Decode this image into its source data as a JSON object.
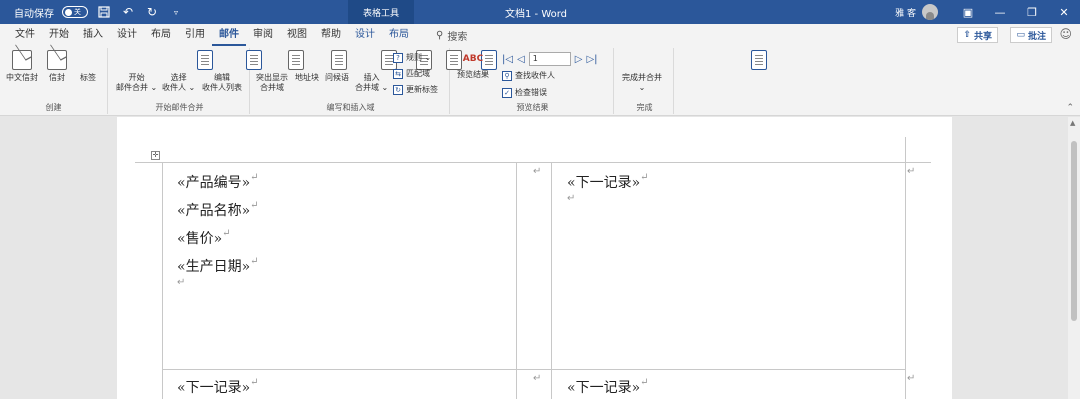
{
  "titlebar": {
    "autosave_label": "自动保存",
    "autosave_state": "关",
    "context_tab": "表格工具",
    "doc_title": "文档1 - Word",
    "user": "雅 客",
    "icons": [
      "save-icon",
      "undo-icon",
      "redo-icon",
      "customize-icon"
    ]
  },
  "tabs": [
    "文件",
    "开始",
    "插入",
    "设计",
    "布局",
    "引用",
    "邮件",
    "审阅",
    "视图",
    "帮助",
    "设计",
    "布局"
  ],
  "active_tab_index": 6,
  "tell_me": "搜索",
  "share_label": "共享",
  "comment_label": "批注",
  "ribbon": {
    "create": {
      "label": "创建",
      "buttons": [
        "中文信封",
        "信封",
        "标签"
      ]
    },
    "start_merge": {
      "label": "开始邮件合并",
      "buttons": [
        "开始\n邮件合并 ⌄",
        "选择\n收件人 ⌄",
        "编辑\n收件人列表"
      ]
    },
    "write_insert": {
      "label": "编写和插入域",
      "buttons": [
        "突出显示\n合并域",
        "地址块",
        "问候语",
        "插入\n合并域 ⌄"
      ],
      "small": [
        "规则 ⌄",
        "匹配域",
        "更新标签"
      ]
    },
    "preview": {
      "label": "预览结果",
      "button": "预览结果",
      "abc": "ABC",
      "record": "1",
      "small": [
        "查找收件人",
        "检查错误"
      ]
    },
    "finish": {
      "label": "完成",
      "button": "完成并合并\n⌄"
    }
  },
  "doc": {
    "cell1": [
      "«产品编号»",
      "«产品名称»",
      "«售价»",
      "«生产日期»"
    ],
    "cell2": "«下一记录»",
    "cell3": "«下一记录»",
    "cell4": "«下一记录»",
    "para_mark": "↵"
  }
}
